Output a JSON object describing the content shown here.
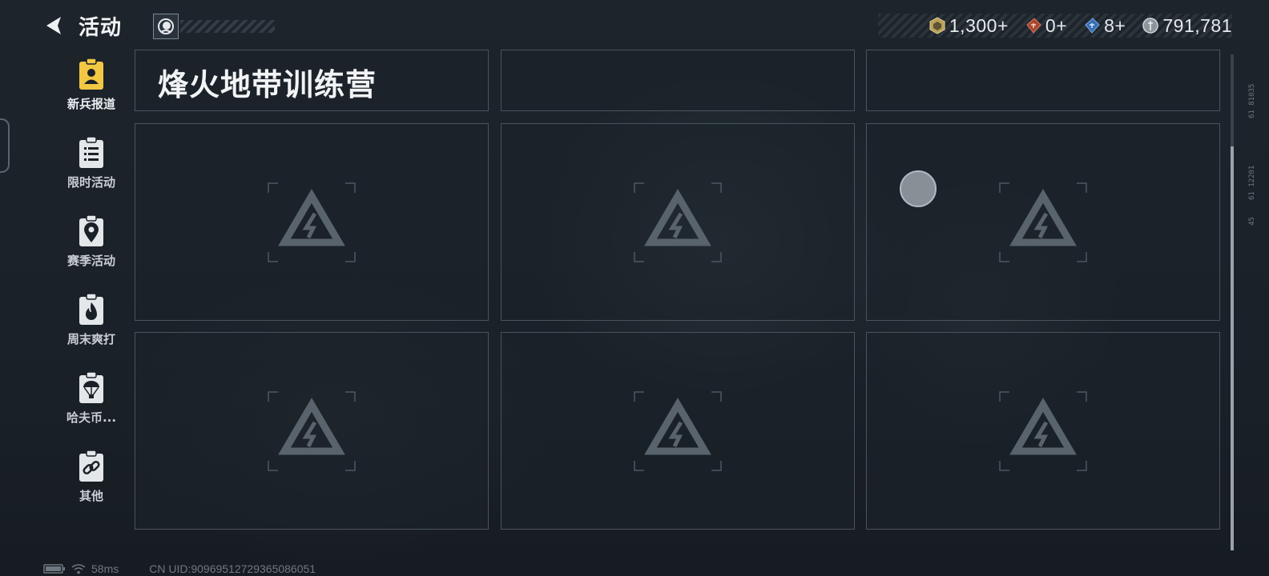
{
  "header": {
    "title": "活动",
    "currencies": [
      {
        "icon": "gold-crate-icon",
        "value": "1,300+"
      },
      {
        "icon": "red-ticket-icon",
        "value": "0+"
      },
      {
        "icon": "blue-ticket-icon",
        "value": "8+"
      },
      {
        "icon": "silver-coin-icon",
        "value": "791,781"
      }
    ]
  },
  "sidebar": {
    "items": [
      {
        "label": "新兵报道",
        "icon": "recruit-clipboard-icon",
        "active": true
      },
      {
        "label": "限时活动",
        "icon": "list-clipboard-icon",
        "active": false
      },
      {
        "label": "赛季活动",
        "icon": "location-clipboard-icon",
        "active": false
      },
      {
        "label": "周末爽打",
        "icon": "flame-clipboard-icon",
        "active": false
      },
      {
        "label": "哈夫币...",
        "icon": "parachute-clipboard-icon",
        "active": false
      },
      {
        "label": "其他",
        "icon": "link-clipboard-icon",
        "active": false
      }
    ]
  },
  "main": {
    "featured_title": "烽火地带训练营"
  },
  "rail_labels": [
    "61 81035",
    "61 12201",
    "45"
  ],
  "status": {
    "ping": "58ms",
    "uid": "CN UID:9096951272936508​6051"
  },
  "colors": {
    "accent_yellow": "#f2c744",
    "card_border": "#4a545c",
    "background": "#1a2027"
  }
}
